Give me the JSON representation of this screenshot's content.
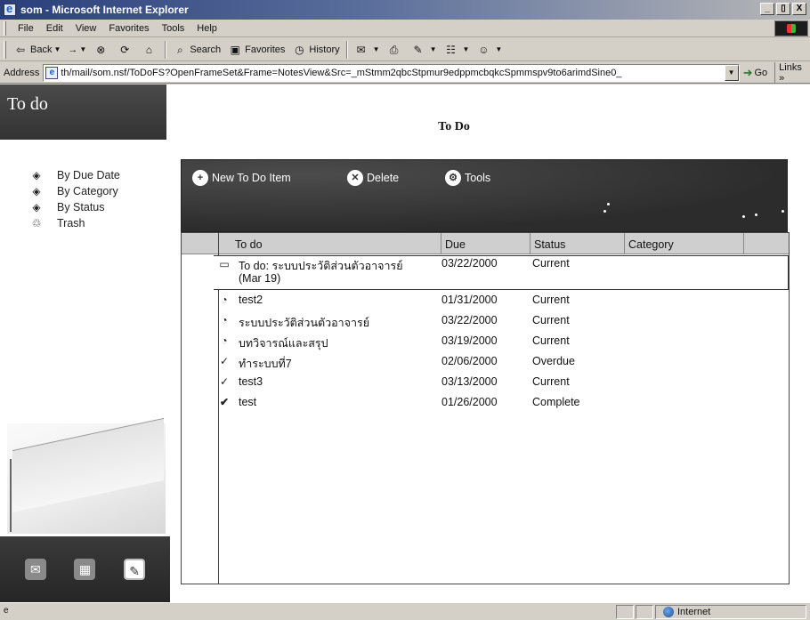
{
  "window": {
    "title": "som - Microsoft Internet Explorer",
    "controls": [
      "_",
      "▯",
      "X"
    ]
  },
  "menu": [
    "File",
    "Edit",
    "View",
    "Favorites",
    "Tools",
    "Help"
  ],
  "toolbar": {
    "back": "Back",
    "forward": "→",
    "search": "Search",
    "favorites": "Favorites",
    "history": "History"
  },
  "address": {
    "label": "Address",
    "url": "th/mail/som.nsf/ToDoFS?OpenFrameSet&Frame=NotesView&Src=_mStmm2qbcStpmur9edppmcbqkcSpmmspv9to6arimdSine0_",
    "go": "Go",
    "links": "Links »"
  },
  "leftnav": {
    "title": "To do",
    "items": [
      {
        "label": "By Due Date",
        "icon": "view-icon"
      },
      {
        "label": "By Category",
        "icon": "view-icon"
      },
      {
        "label": "By Status",
        "icon": "view-icon"
      },
      {
        "label": "Trash",
        "icon": "trash-icon"
      }
    ]
  },
  "main": {
    "title": "To Do",
    "actions": [
      {
        "label": "New To Do Item",
        "icon": "new-item-icon"
      },
      {
        "label": "Delete",
        "icon": "delete-icon"
      },
      {
        "label": "Tools",
        "icon": "tools-icon"
      }
    ],
    "columns": [
      "To do",
      "Due",
      "Status",
      "Category"
    ],
    "rows": [
      {
        "icon": "folder-icon",
        "todo": "To do: ระบบประวัติส่วนตัวอาจารย์",
        "todo2": "(Mar 19)",
        "due": "03/22/2000",
        "status": "Current",
        "category": ""
      },
      {
        "icon": "clock-icon",
        "todo": "test2",
        "due": "01/31/2000",
        "status": "Current",
        "category": ""
      },
      {
        "icon": "clock-icon",
        "todo": "ระบบประวัติส่วนตัวอาจารย์",
        "due": "03/22/2000",
        "status": "Current",
        "category": ""
      },
      {
        "icon": "clock-icon",
        "todo": "บทวิจารณ์และสรุป",
        "due": "03/19/2000",
        "status": "Current",
        "category": ""
      },
      {
        "icon": "pen-check-icon",
        "todo": "ทำระบบที่7",
        "due": "02/06/2000",
        "status": "Overdue",
        "category": ""
      },
      {
        "icon": "pen-check-icon",
        "todo": "test3",
        "due": "03/13/2000",
        "status": "Current",
        "category": ""
      },
      {
        "icon": "checkmark-icon",
        "todo": "test",
        "due": "01/26/2000",
        "status": "Complete",
        "category": ""
      }
    ]
  },
  "status": {
    "zone": "Internet"
  }
}
